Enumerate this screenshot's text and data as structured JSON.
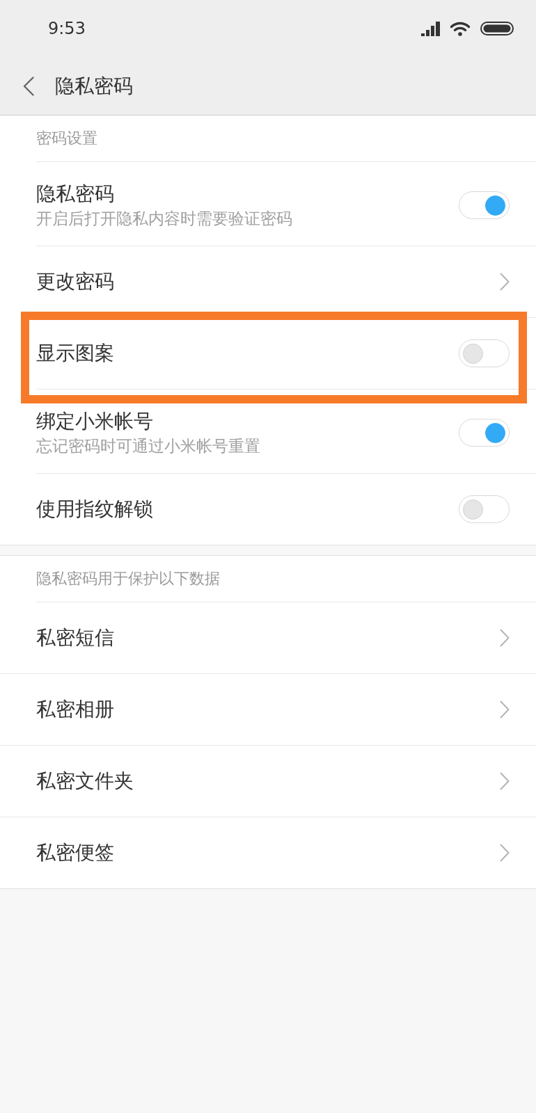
{
  "status_bar": {
    "time": "9:53"
  },
  "header": {
    "title": "隐私密码"
  },
  "sections": [
    {
      "title": "密码设置",
      "items": [
        {
          "kind": "toggle",
          "title": "隐私密码",
          "subtitle": "开启后打开隐私内容时需要验证密码",
          "on": true,
          "highlighted": false
        },
        {
          "kind": "link",
          "title": "更改密码",
          "highlighted": false
        },
        {
          "kind": "toggle",
          "title": "显示图案",
          "on": false,
          "highlighted": true
        },
        {
          "kind": "toggle",
          "title": "绑定小米帐号",
          "subtitle": "忘记密码时可通过小米帐号重置",
          "on": true,
          "highlighted": false
        },
        {
          "kind": "toggle",
          "title": "使用指纹解锁",
          "on": false,
          "highlighted": false
        }
      ]
    },
    {
      "title": "隐私密码用于保护以下数据",
      "items": [
        {
          "kind": "link",
          "title": "私密短信",
          "highlighted": false
        },
        {
          "kind": "link",
          "title": "私密相册",
          "highlighted": false
        },
        {
          "kind": "link",
          "title": "私密文件夹",
          "highlighted": false
        },
        {
          "kind": "link",
          "title": "私密便签",
          "highlighted": false
        }
      ]
    }
  ]
}
